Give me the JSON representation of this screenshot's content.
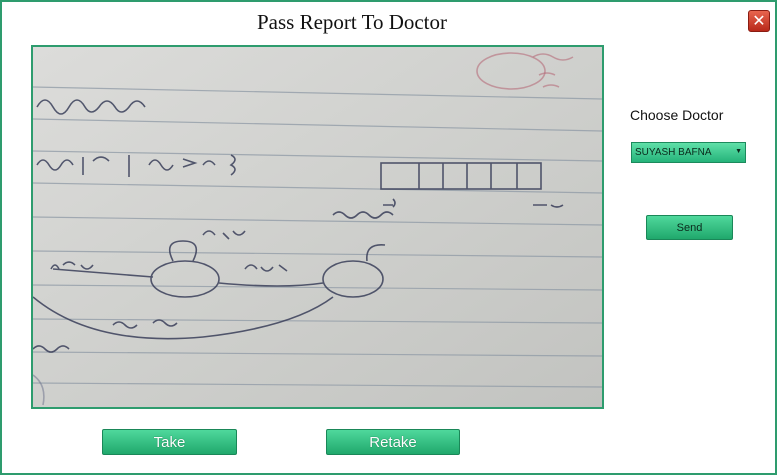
{
  "window": {
    "title": "Pass Report To Doctor",
    "close_label": "✕"
  },
  "camera": {
    "description_hidden": ""
  },
  "sidebar": {
    "choose_label": "Choose Doctor",
    "doctor_selected": "SUYASH BAFNA",
    "send_label": "Send"
  },
  "actions": {
    "take_label": "Take",
    "retake_label": "Retake"
  },
  "colors": {
    "accent": "#2e9c6e",
    "button": "#20a86c",
    "close": "#c0392b"
  }
}
